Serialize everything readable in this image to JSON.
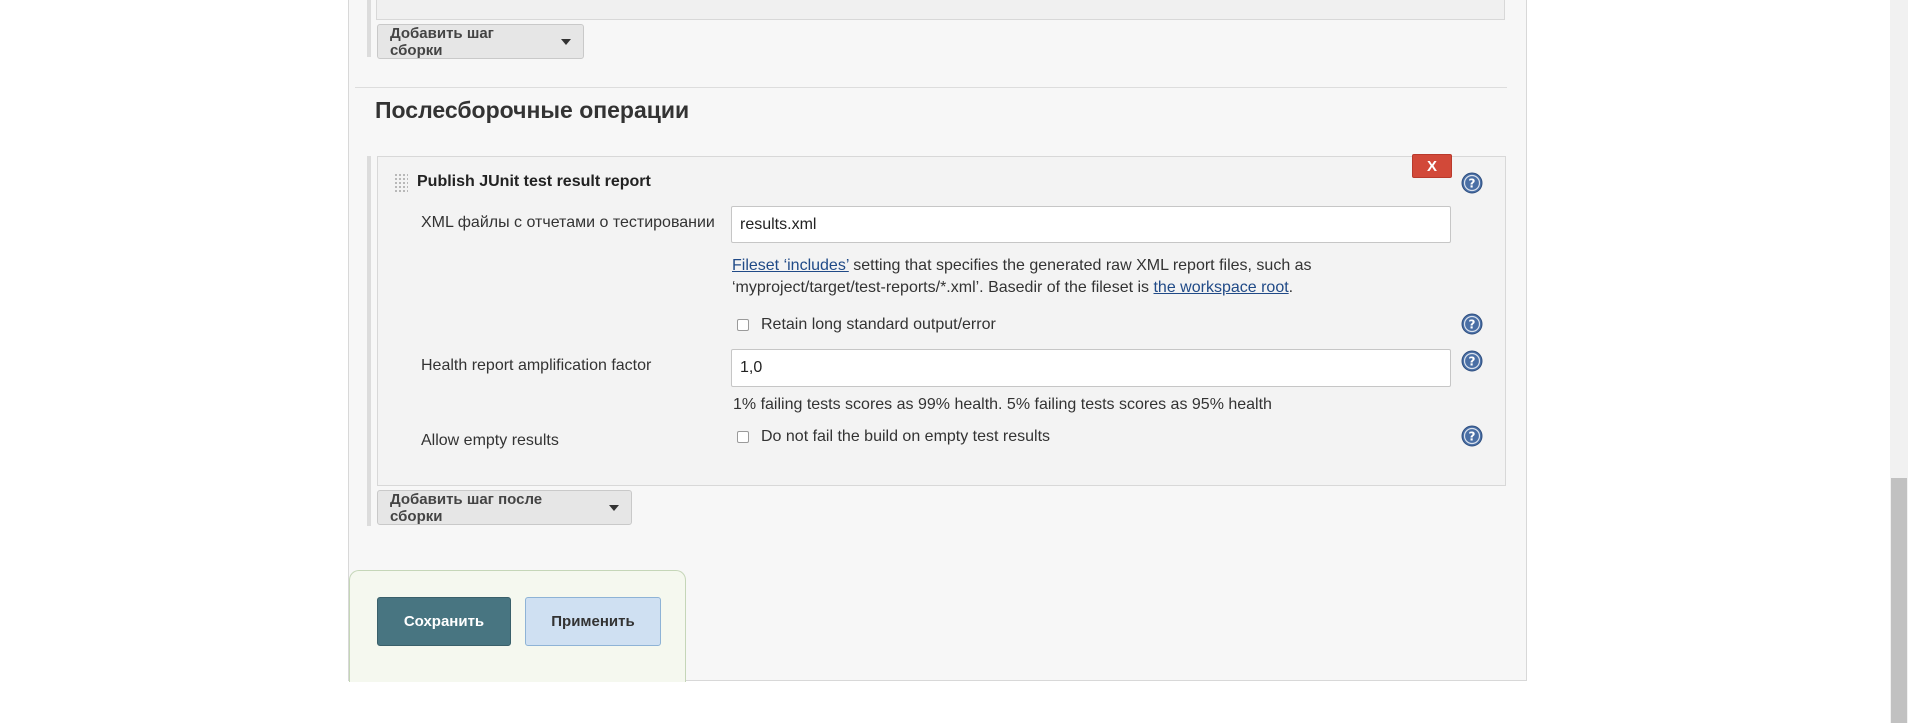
{
  "build_steps": {
    "add_step_label": "Добавить шаг сборки"
  },
  "post_build": {
    "section_title": "Послесборочные операции",
    "add_step_label": "Добавить шаг после сборки",
    "junit_step": {
      "title": "Publish JUnit test result report",
      "delete_label": "X",
      "xml_files": {
        "label": "XML файлы с отчетами о тестировании",
        "value": "results.xml"
      },
      "description": {
        "link1": "Fileset ‘includes’",
        "text1": " setting that specifies the generated raw XML report files, such as ‘myproject/target/test-reports/*.xml’. Basedir of the fileset is ",
        "link2": "the workspace root",
        "text2": "."
      },
      "retain_output": {
        "label": "Retain long standard output/error",
        "checked": false
      },
      "health_factor": {
        "label": "Health report amplification factor",
        "value": "1,0",
        "hint": "1% failing tests scores as 99% health. 5% failing tests scores as 95% health"
      },
      "allow_empty": {
        "label": "Allow empty results",
        "checkbox_label": "Do not fail the build on empty test results",
        "checked": false
      }
    }
  },
  "actions": {
    "save_label": "Сохранить",
    "apply_label": "Применить"
  },
  "colors": {
    "primary_button": "#487581",
    "secondary_button": "#cfe0f2",
    "delete_button": "#d24939",
    "help_icon": "#4a6fa5",
    "link": "#204a87"
  },
  "icons": {
    "help": "help-icon",
    "drag": "drag-handle-icon",
    "dropdown": "caret-down-icon"
  }
}
